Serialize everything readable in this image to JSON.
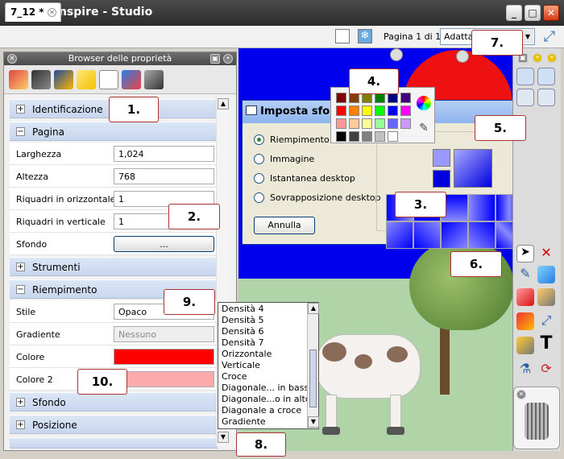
{
  "window": {
    "title": "ActivInspire - Studio"
  },
  "tabbar": {
    "doc_tab": "7_12 *",
    "page_info": "Pagina 1 di 1",
    "zoom_value": "Adatta"
  },
  "props_panel": {
    "title": "Browser delle proprietà",
    "sections": {
      "identificazione": "Identificazione",
      "pagina": "Pagina",
      "strumenti": "Strumenti",
      "riempimento": "Riempimento",
      "sfondo": "Sfondo",
      "posizione": "Posizione"
    },
    "pagina_rows": {
      "larghezza_label": "Larghezza",
      "larghezza_value": "1,024",
      "altezza_label": "Altezza",
      "altezza_value": "768",
      "oriz_label": "Riquadri in orizzontale",
      "oriz_value": "1",
      "vert_label": "Riquadri in verticale",
      "vert_value": "1",
      "sfondo_label": "Sfondo",
      "sfondo_button": "..."
    },
    "riempimento_rows": {
      "stile_label": "Stile",
      "stile_value": "Opaco",
      "gradiente_label": "Gradiente",
      "gradiente_value": "Nessuno",
      "colore_label": "Colore",
      "colore2_label": "Colore 2"
    }
  },
  "dialog": {
    "title": "Imposta sfondo",
    "options": [
      "Riempimento",
      "Immagine",
      "Istantanea desktop",
      "Sovrapposizione desktop"
    ],
    "cancel_label": "Annulla"
  },
  "gradient_list": [
    "Densità 4",
    "Densità 5",
    "Densità 6",
    "Densità 7",
    "Orizzontale",
    "Verticale",
    "Croce",
    "Diagonale... in basso",
    "Diagonale...o in alto",
    "Diagonale a croce",
    "Gradiente"
  ],
  "callouts": [
    "1.",
    "2.",
    "3.",
    "4.",
    "5.",
    "6.",
    "7.",
    "8.",
    "9.",
    "10."
  ],
  "colors": {
    "accent_red": "#ff0000",
    "canvas_blue": "#0000ee",
    "grass": "#b1d3a8",
    "colore2_pink": "#ffaaaa"
  }
}
